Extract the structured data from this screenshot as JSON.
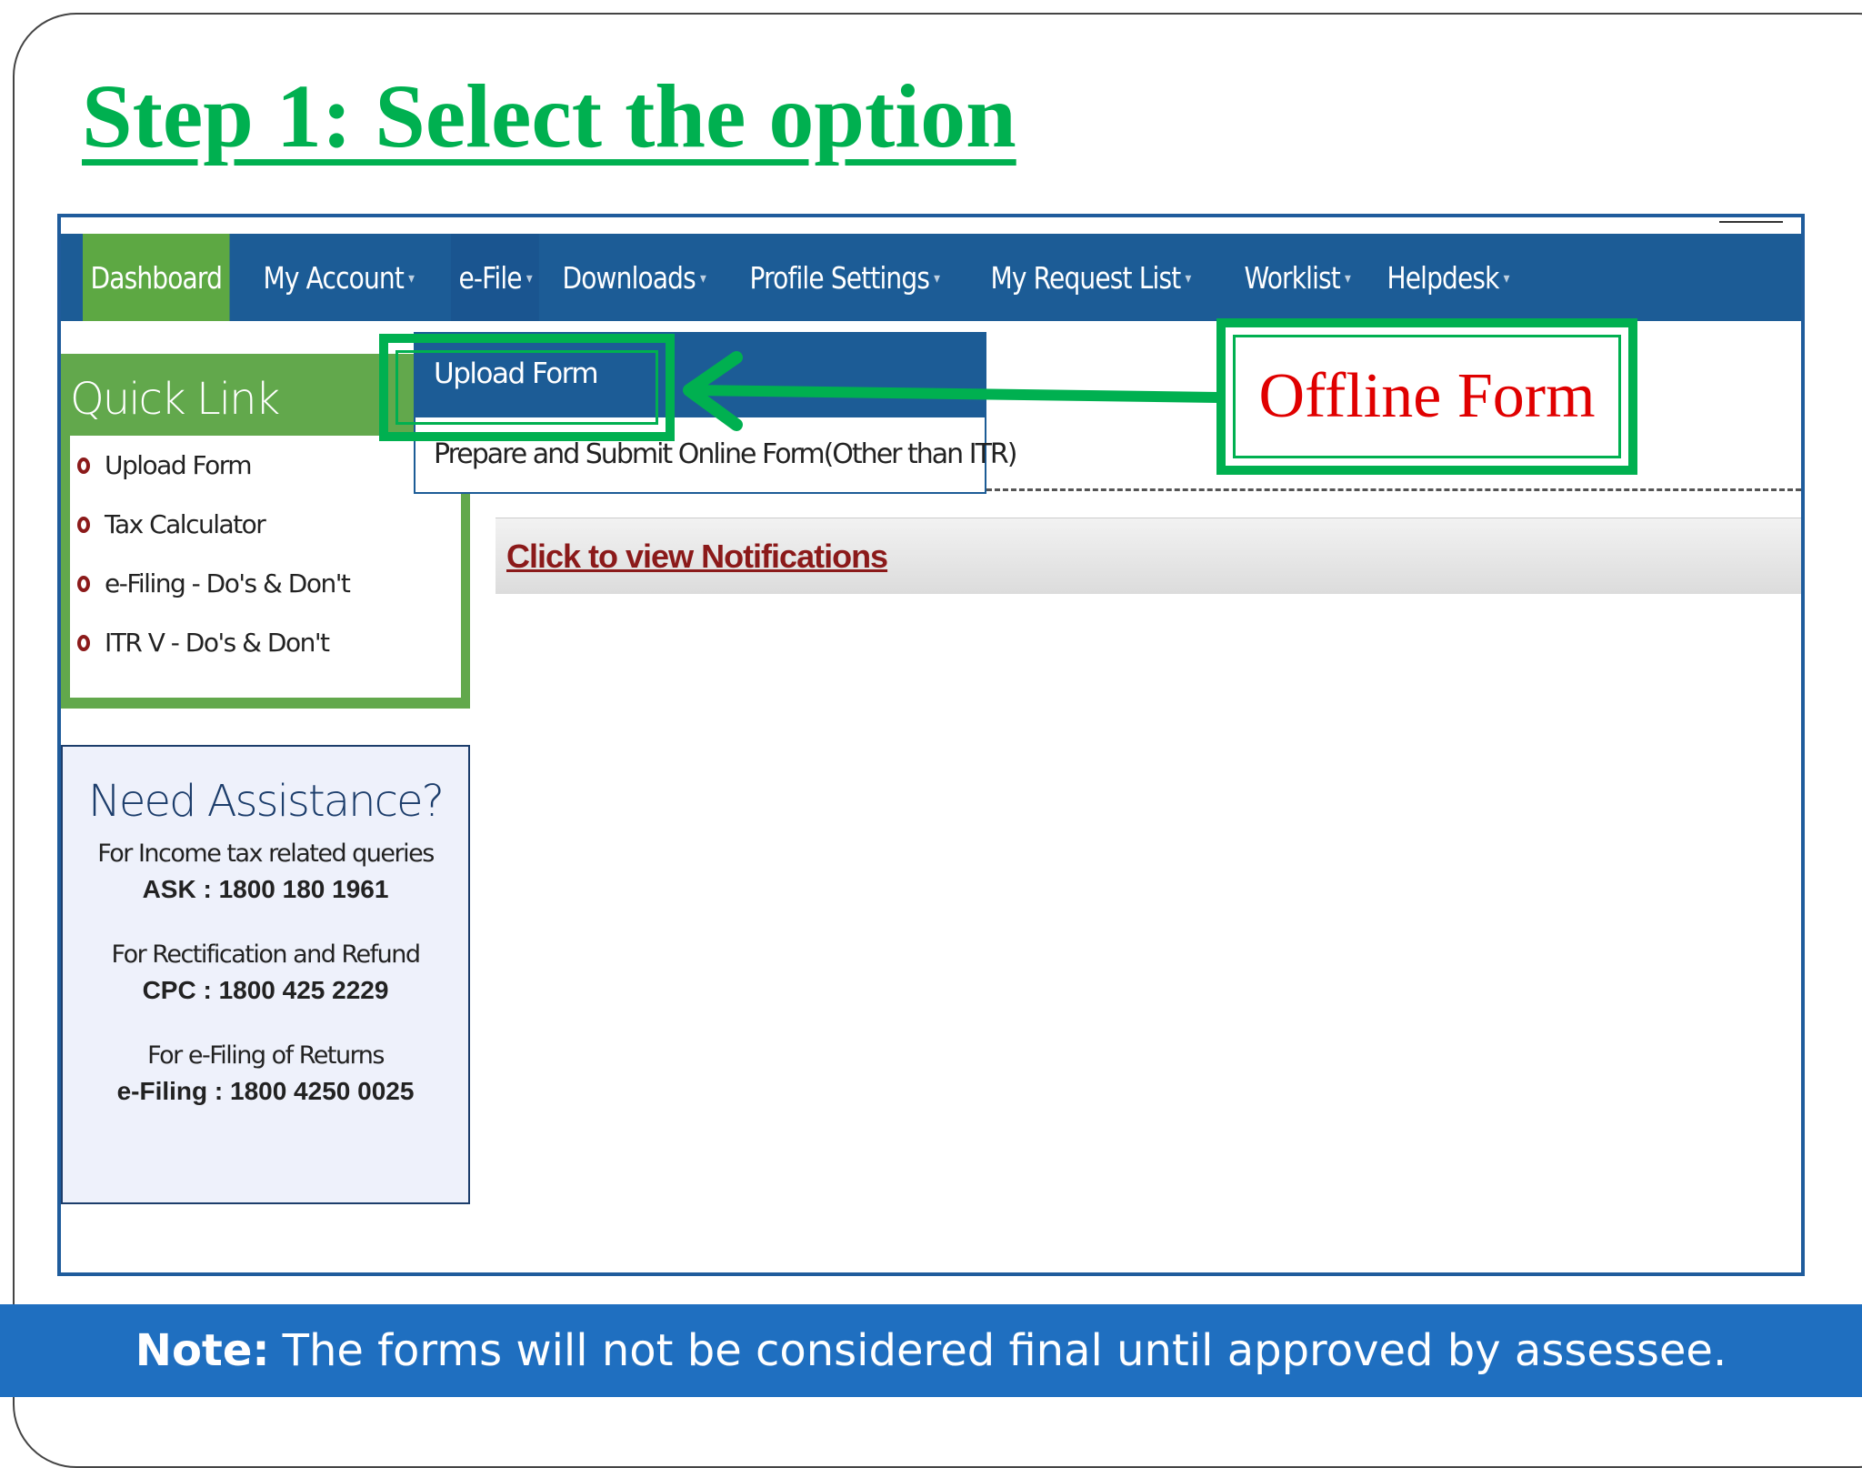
{
  "slide": {
    "title": "Step 1: Select the option",
    "callout": "Offline Form",
    "note_label": "Note:",
    "note_text": "The forms will not be considered final until approved by assessee."
  },
  "navbar": {
    "items": [
      {
        "label": "Dashboard",
        "active": true
      },
      {
        "label": "My Account"
      },
      {
        "label": "e-File",
        "open": true
      },
      {
        "label": "Downloads"
      },
      {
        "label": "Profile Settings"
      },
      {
        "label": "My Request List"
      },
      {
        "label": "Worklist"
      },
      {
        "label": "Helpdesk"
      }
    ]
  },
  "dropdown": {
    "items": [
      "Upload Form",
      "Prepare and Submit Online Form(Other than ITR)"
    ]
  },
  "quick_link": {
    "title": "Quick Link",
    "items": [
      "Upload Form",
      "Tax Calculator",
      "e-Filing - Do's & Don't",
      "ITR V - Do's & Don't"
    ]
  },
  "assistance": {
    "title": "Need Assistance?",
    "groups": [
      {
        "line": "For Income tax related queries",
        "number": "ASK : 1800 180 1961"
      },
      {
        "line": "For Rectification and Refund",
        "number": "CPC : 1800 425 2229"
      },
      {
        "line": "For e-Filing of Returns",
        "number": "e-Filing : 1800 4250 0025"
      }
    ]
  },
  "notifications": {
    "link": "Click to view Notifications"
  },
  "colors": {
    "accent_green": "#00b050",
    "nav_blue": "#1c5c96",
    "callout_red": "#e00000",
    "note_blue": "#1f6fc0"
  }
}
